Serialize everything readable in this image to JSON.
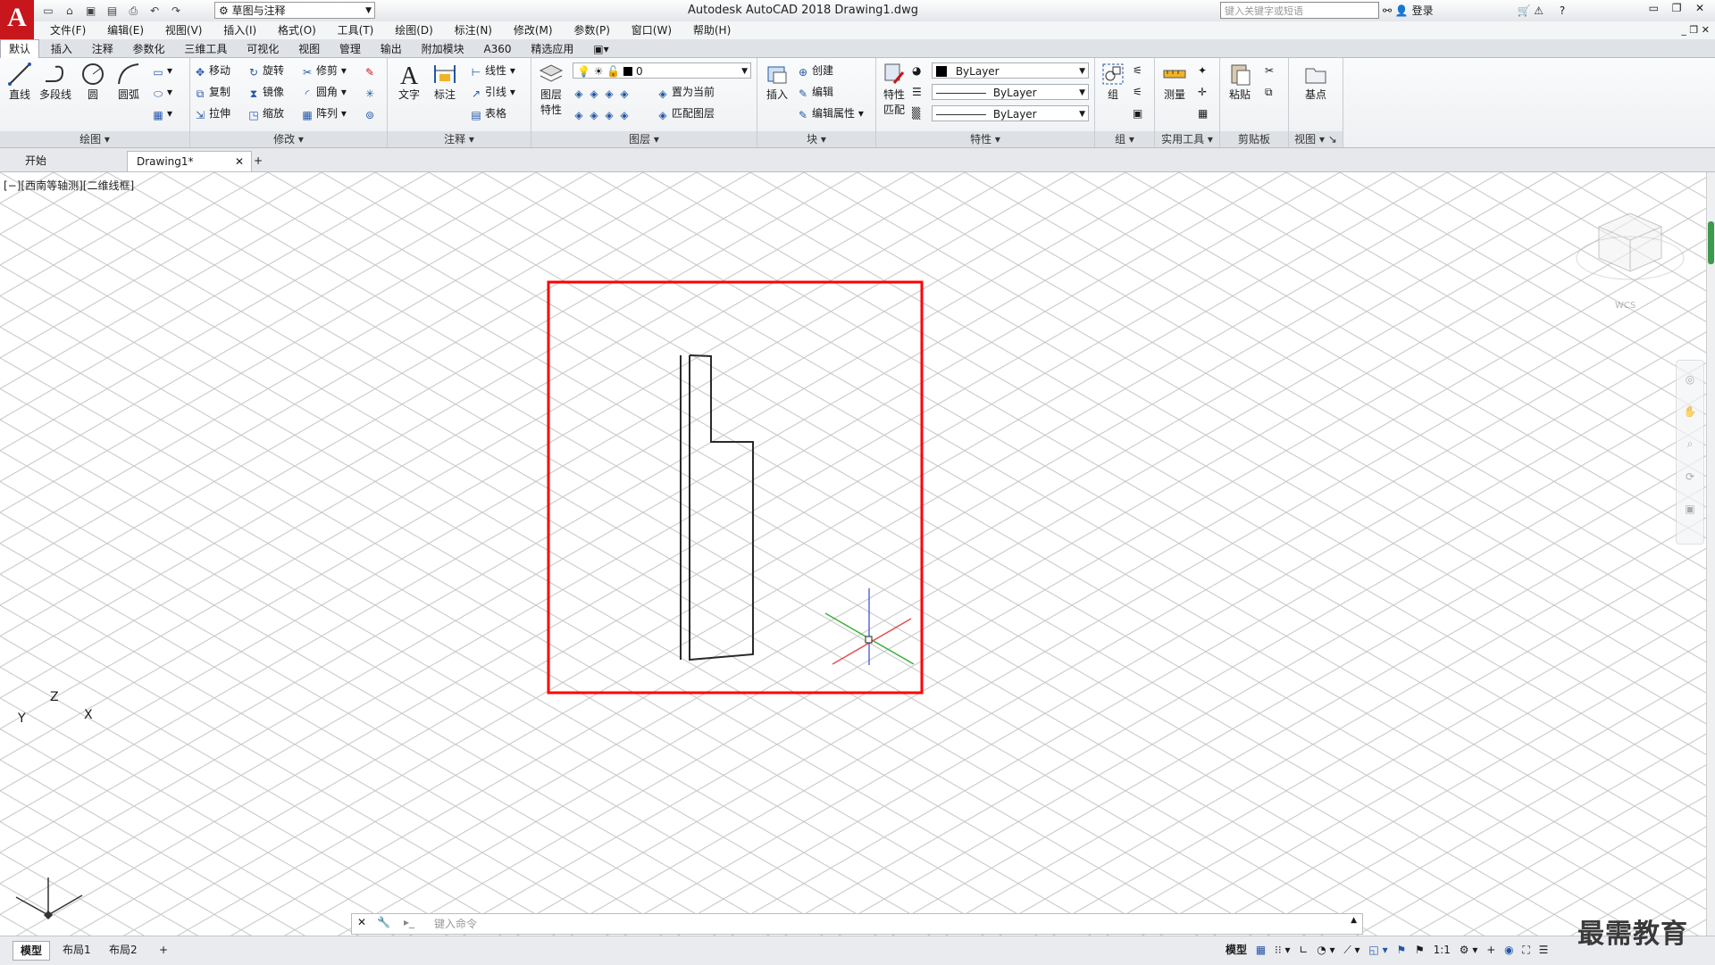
{
  "app": {
    "logo": "A",
    "title": "Autodesk AutoCAD 2018    Drawing1.dwg",
    "workspace": "草图与注释"
  },
  "search": {
    "placeholder": "键入关键字或短语"
  },
  "user": {
    "login": "登录"
  },
  "menu": [
    "文件(F)",
    "编辑(E)",
    "视图(V)",
    "插入(I)",
    "格式(O)",
    "工具(T)",
    "绘图(D)",
    "标注(N)",
    "修改(M)",
    "参数(P)",
    "窗口(W)",
    "帮助(H)"
  ],
  "ribbon_tabs": [
    "默认",
    "插入",
    "注释",
    "参数化",
    "三维工具",
    "可视化",
    "视图",
    "管理",
    "输出",
    "附加模块",
    "A360",
    "精选应用"
  ],
  "ribbon": {
    "draw": {
      "title": "绘图",
      "line": "直线",
      "polyline": "多段线",
      "circle": "圆",
      "arc": "圆弧"
    },
    "modify": {
      "title": "修改",
      "move": "移动",
      "rotate": "旋转",
      "trim": "修剪",
      "copy": "复制",
      "mirror": "镜像",
      "fillet": "圆角",
      "stretch": "拉伸",
      "scale": "缩放",
      "array": "阵列"
    },
    "annotation": {
      "title": "注释",
      "text": "文字",
      "dimension": "标注",
      "linear": "线性",
      "leader": "引线",
      "table": "表格"
    },
    "layers": {
      "title": "图层",
      "layer_props_line1": "图层",
      "layer_props_line2": "特性",
      "current_layer": "0",
      "set_current": "置为当前",
      "match_layer": "匹配图层"
    },
    "block": {
      "title": "块",
      "insert": "插入",
      "create": "创建",
      "edit": "编辑",
      "edit_attr": "编辑属性"
    },
    "properties": {
      "title": "特性",
      "match_line1": "特性",
      "match_line2": "匹配",
      "color": "ByLayer",
      "linetype": "ByLayer",
      "lineweight": "ByLayer"
    },
    "groups": {
      "title": "组",
      "group": "组"
    },
    "utilities": {
      "title": "实用工具",
      "measure": "测量"
    },
    "clipboard": {
      "title": "剪贴板",
      "paste": "粘贴"
    },
    "view": {
      "title": "视图",
      "base": "基点"
    }
  },
  "doc_tabs": {
    "start": "开始",
    "drawing": "Drawing1*"
  },
  "viewport": {
    "label": "[−][西南等轴测][二维线框]",
    "wcs": "WCS"
  },
  "axes": {
    "x": "X",
    "y": "Y",
    "z": "Z"
  },
  "command": {
    "prompt": "键入命令"
  },
  "layout_tabs": [
    "模型",
    "布局1",
    "布局2"
  ],
  "status": {
    "model": "模型",
    "scale": "1:1"
  },
  "watermark": "最需教育",
  "colors": {
    "accent": "#c8161d",
    "highlight_frame": "#ff0000",
    "grid": "#c6c6c6"
  }
}
